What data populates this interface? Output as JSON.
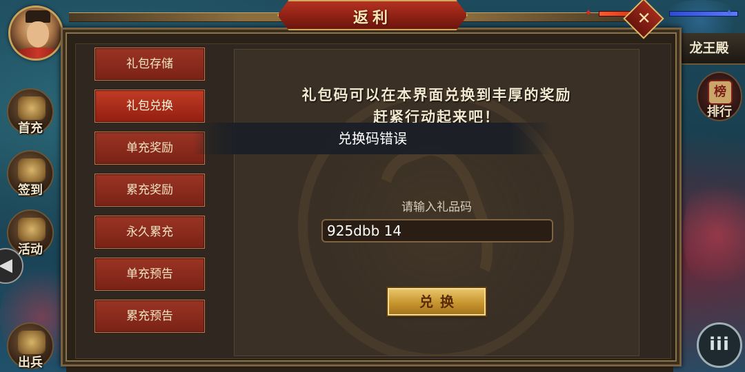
{
  "window": {
    "title": "返利"
  },
  "player": {
    "avatar_icon": "warrior-portrait-icon"
  },
  "left_menu": [
    {
      "label": "首充",
      "icon": "money-bag-icon"
    },
    {
      "label": "签到",
      "icon": "scroll-brush-icon"
    },
    {
      "label": "活动",
      "icon": "treasure-chest-icon"
    },
    {
      "label": "出兵",
      "icon": "crossed-swords-icon"
    }
  ],
  "right_menu": {
    "location": "龙王殿",
    "rank_label": "排行",
    "rank_icon_text": "榜",
    "more_label": "iii"
  },
  "tabs": [
    {
      "label": "礼包存储",
      "active": false
    },
    {
      "label": "礼包兑换",
      "active": true
    },
    {
      "label": "单充奖励",
      "active": false
    },
    {
      "label": "累充奖励",
      "active": false
    },
    {
      "label": "永久累充",
      "active": false
    },
    {
      "label": "单充预告",
      "active": false
    },
    {
      "label": "累充预告",
      "active": false
    }
  ],
  "redeem": {
    "headline_line1": "礼包码可以在本界面兑换到丰厚的奖励",
    "headline_line2": "赶紧行动起来吧！",
    "input_label": "请输入礼品码",
    "input_value": "925dbb 14",
    "button_label": "兑换"
  },
  "toast": {
    "message": "兑换码错误"
  },
  "colors": {
    "tab_red": "#9a3424",
    "title_red": "#b3321f",
    "gold": "#d4a85c",
    "button_gold": "#e7c36a"
  }
}
